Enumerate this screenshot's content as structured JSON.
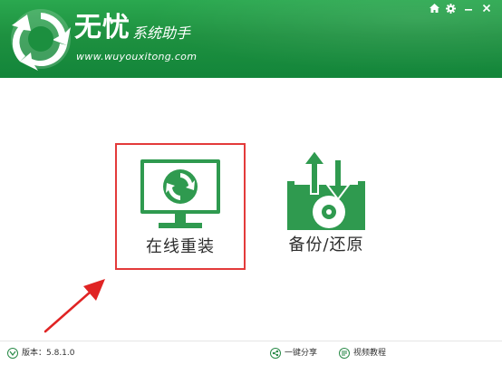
{
  "header": {
    "title": "无忧",
    "subtitle": "系统助手",
    "url": "www.wuyouxitong.com",
    "controls": [
      {
        "icon": "home-icon"
      },
      {
        "icon": "gear-icon"
      },
      {
        "icon": "minimize-icon"
      },
      {
        "icon": "close-icon"
      }
    ]
  },
  "main": {
    "options": [
      {
        "label": "在线重装",
        "icon": "monitor-refresh-icon",
        "selected": true
      },
      {
        "label": "备份/还原",
        "icon": "disk-backup-icon",
        "selected": false
      }
    ]
  },
  "footer": {
    "version_label": "版本：5.8.1.0",
    "share_label": "一键分享",
    "tutorial_label": "视频教程"
  },
  "colors": {
    "brand_green": "#1e9140",
    "icon_green": "#2f9a4f",
    "highlight_red": "#e33b3b",
    "arrow_red": "#e02424"
  }
}
